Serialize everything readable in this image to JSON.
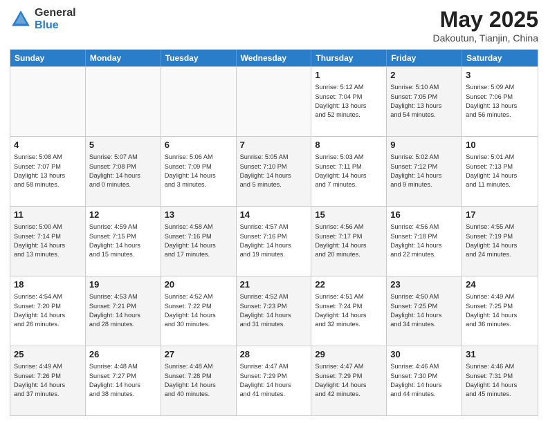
{
  "header": {
    "title": "May 2025",
    "subtitle": "Dakoutun, Tianjin, China",
    "logo_general": "General",
    "logo_blue": "Blue"
  },
  "weekdays": [
    "Sunday",
    "Monday",
    "Tuesday",
    "Wednesday",
    "Thursday",
    "Friday",
    "Saturday"
  ],
  "rows": [
    [
      {
        "day": "",
        "text": "",
        "empty": true
      },
      {
        "day": "",
        "text": "",
        "empty": true
      },
      {
        "day": "",
        "text": "",
        "empty": true
      },
      {
        "day": "",
        "text": "",
        "empty": true
      },
      {
        "day": "1",
        "text": "Sunrise: 5:12 AM\nSunset: 7:04 PM\nDaylight: 13 hours\nand 52 minutes.",
        "empty": false,
        "alt": false
      },
      {
        "day": "2",
        "text": "Sunrise: 5:10 AM\nSunset: 7:05 PM\nDaylight: 13 hours\nand 54 minutes.",
        "empty": false,
        "alt": true
      },
      {
        "day": "3",
        "text": "Sunrise: 5:09 AM\nSunset: 7:06 PM\nDaylight: 13 hours\nand 56 minutes.",
        "empty": false,
        "alt": false
      }
    ],
    [
      {
        "day": "4",
        "text": "Sunrise: 5:08 AM\nSunset: 7:07 PM\nDaylight: 13 hours\nand 58 minutes.",
        "empty": false,
        "alt": false
      },
      {
        "day": "5",
        "text": "Sunrise: 5:07 AM\nSunset: 7:08 PM\nDaylight: 14 hours\nand 0 minutes.",
        "empty": false,
        "alt": true
      },
      {
        "day": "6",
        "text": "Sunrise: 5:06 AM\nSunset: 7:09 PM\nDaylight: 14 hours\nand 3 minutes.",
        "empty": false,
        "alt": false
      },
      {
        "day": "7",
        "text": "Sunrise: 5:05 AM\nSunset: 7:10 PM\nDaylight: 14 hours\nand 5 minutes.",
        "empty": false,
        "alt": true
      },
      {
        "day": "8",
        "text": "Sunrise: 5:03 AM\nSunset: 7:11 PM\nDaylight: 14 hours\nand 7 minutes.",
        "empty": false,
        "alt": false
      },
      {
        "day": "9",
        "text": "Sunrise: 5:02 AM\nSunset: 7:12 PM\nDaylight: 14 hours\nand 9 minutes.",
        "empty": false,
        "alt": true
      },
      {
        "day": "10",
        "text": "Sunrise: 5:01 AM\nSunset: 7:13 PM\nDaylight: 14 hours\nand 11 minutes.",
        "empty": false,
        "alt": false
      }
    ],
    [
      {
        "day": "11",
        "text": "Sunrise: 5:00 AM\nSunset: 7:14 PM\nDaylight: 14 hours\nand 13 minutes.",
        "empty": false,
        "alt": true
      },
      {
        "day": "12",
        "text": "Sunrise: 4:59 AM\nSunset: 7:15 PM\nDaylight: 14 hours\nand 15 minutes.",
        "empty": false,
        "alt": false
      },
      {
        "day": "13",
        "text": "Sunrise: 4:58 AM\nSunset: 7:16 PM\nDaylight: 14 hours\nand 17 minutes.",
        "empty": false,
        "alt": true
      },
      {
        "day": "14",
        "text": "Sunrise: 4:57 AM\nSunset: 7:16 PM\nDaylight: 14 hours\nand 19 minutes.",
        "empty": false,
        "alt": false
      },
      {
        "day": "15",
        "text": "Sunrise: 4:56 AM\nSunset: 7:17 PM\nDaylight: 14 hours\nand 20 minutes.",
        "empty": false,
        "alt": true
      },
      {
        "day": "16",
        "text": "Sunrise: 4:56 AM\nSunset: 7:18 PM\nDaylight: 14 hours\nand 22 minutes.",
        "empty": false,
        "alt": false
      },
      {
        "day": "17",
        "text": "Sunrise: 4:55 AM\nSunset: 7:19 PM\nDaylight: 14 hours\nand 24 minutes.",
        "empty": false,
        "alt": true
      }
    ],
    [
      {
        "day": "18",
        "text": "Sunrise: 4:54 AM\nSunset: 7:20 PM\nDaylight: 14 hours\nand 26 minutes.",
        "empty": false,
        "alt": false
      },
      {
        "day": "19",
        "text": "Sunrise: 4:53 AM\nSunset: 7:21 PM\nDaylight: 14 hours\nand 28 minutes.",
        "empty": false,
        "alt": true
      },
      {
        "day": "20",
        "text": "Sunrise: 4:52 AM\nSunset: 7:22 PM\nDaylight: 14 hours\nand 30 minutes.",
        "empty": false,
        "alt": false
      },
      {
        "day": "21",
        "text": "Sunrise: 4:52 AM\nSunset: 7:23 PM\nDaylight: 14 hours\nand 31 minutes.",
        "empty": false,
        "alt": true
      },
      {
        "day": "22",
        "text": "Sunrise: 4:51 AM\nSunset: 7:24 PM\nDaylight: 14 hours\nand 32 minutes.",
        "empty": false,
        "alt": false
      },
      {
        "day": "23",
        "text": "Sunrise: 4:50 AM\nSunset: 7:25 PM\nDaylight: 14 hours\nand 34 minutes.",
        "empty": false,
        "alt": true
      },
      {
        "day": "24",
        "text": "Sunrise: 4:49 AM\nSunset: 7:25 PM\nDaylight: 14 hours\nand 36 minutes.",
        "empty": false,
        "alt": false
      }
    ],
    [
      {
        "day": "25",
        "text": "Sunrise: 4:49 AM\nSunset: 7:26 PM\nDaylight: 14 hours\nand 37 minutes.",
        "empty": false,
        "alt": true
      },
      {
        "day": "26",
        "text": "Sunrise: 4:48 AM\nSunset: 7:27 PM\nDaylight: 14 hours\nand 38 minutes.",
        "empty": false,
        "alt": false
      },
      {
        "day": "27",
        "text": "Sunrise: 4:48 AM\nSunset: 7:28 PM\nDaylight: 14 hours\nand 40 minutes.",
        "empty": false,
        "alt": true
      },
      {
        "day": "28",
        "text": "Sunrise: 4:47 AM\nSunset: 7:29 PM\nDaylight: 14 hours\nand 41 minutes.",
        "empty": false,
        "alt": false
      },
      {
        "day": "29",
        "text": "Sunrise: 4:47 AM\nSunset: 7:29 PM\nDaylight: 14 hours\nand 42 minutes.",
        "empty": false,
        "alt": true
      },
      {
        "day": "30",
        "text": "Sunrise: 4:46 AM\nSunset: 7:30 PM\nDaylight: 14 hours\nand 44 minutes.",
        "empty": false,
        "alt": false
      },
      {
        "day": "31",
        "text": "Sunrise: 4:46 AM\nSunset: 7:31 PM\nDaylight: 14 hours\nand 45 minutes.",
        "empty": false,
        "alt": true
      }
    ]
  ]
}
